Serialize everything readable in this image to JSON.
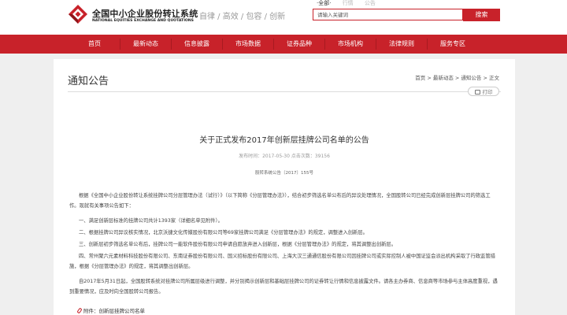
{
  "header": {
    "brand_cn": "全国中小企业股份转让系统",
    "brand_en": "NATIONAL EQUITIES EXCHANGE AND QUOTATIONS",
    "slogan": "自律 / 高效 / 包容 / 创新",
    "search_tabs": [
      "·全部·",
      "行情",
      "公告"
    ],
    "search_placeholder": "请输入关键词",
    "search_button": "搜索",
    "brand_color": "#c8222a"
  },
  "nav": {
    "items": [
      "首页",
      "最新动态",
      "信息披露",
      "市场数据",
      "证券品种",
      "市场机构",
      "法律规则",
      "服务专区"
    ]
  },
  "page": {
    "section_title": "通知公告",
    "breadcrumb": "首页 > 最新动态 > 通知公告 > 正文",
    "print_label": "打印"
  },
  "article": {
    "title": "关于正式发布2017年创新层挂牌公司名单的公告",
    "meta": "发布时间：2017-05-30  点击次数：39156",
    "doc_number": "股转系统公告〔2017〕155号",
    "paragraphs": [
      "根据《全国中小企业股份转让系统挂牌公司分层管理办法（试行）》（以下简称《分层管理办法》），结合初步筛选名单公布后的异议处理情况，全国股转公司已经完成创新层挂牌公司的筛选工作。现就有关事项公告如下：",
      "一、满足创新层标准的挂牌公司共计1393家（详细名单见附件）。",
      "二、根据挂牌公司异议核实情况，北京沃捷文化传媒股份有限公司等69家挂牌公司满足《分层管理办法》的规定，调整进入创新层。",
      "三、创新层初步筛选名单公布后，挂牌公司一能软件股份有限公司申请自愿放弃进入创新层，根据《分层管理办法》的规定，将其调整出创新层。",
      "四、常州聚六元素材料科技股份有限公司、东南证券股份有限公司、国义招标股份有限公司、上海大汉三通通信股份有限公司因挂牌公司或实际控制人被中国证监会派出机构采取了行政监管措施，根据《分层管理办法》的规定，将其调整出创新层。",
      "自2017年5月31日起，全国股转系统对挂牌公司所属层级进行调整，并分别揭示创新层和基础层挂牌公司的证券转让行情和信息披露文件。请各主办券商、信息商等市场参与主体高度重视，遇到重要情况，应及时向全国股转公司报告。"
    ],
    "attachment_label": "附件：创新层挂牌公司名单"
  }
}
